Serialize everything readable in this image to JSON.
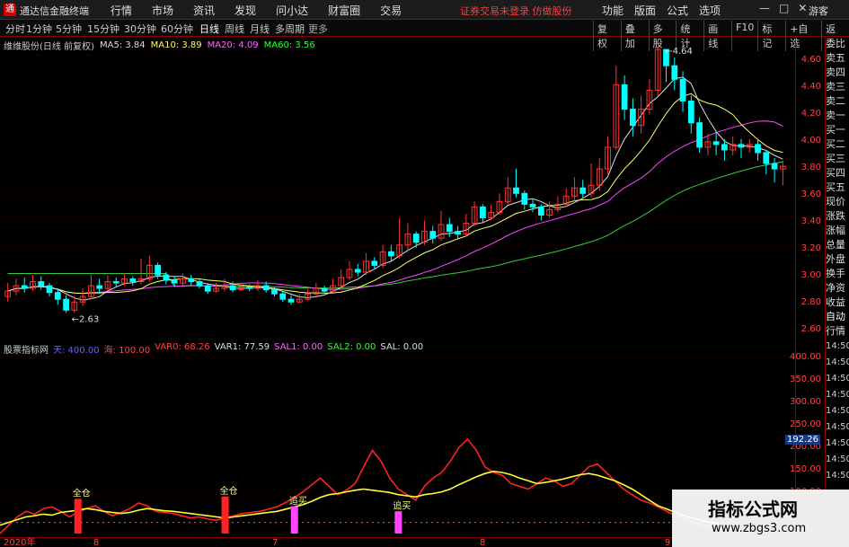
{
  "app": {
    "title": "通达信金融终端",
    "logo_glyph": "通",
    "guest": "游客"
  },
  "menu": [
    "行情",
    "市场",
    "资讯",
    "发现",
    "问小达",
    "财富圈",
    "交易"
  ],
  "warning": "证券交易未登录  仿做股份",
  "right_menu": [
    "功能",
    "版面",
    "公式",
    "选项"
  ],
  "window_controls": [
    "—",
    "□",
    "✕"
  ],
  "periods": [
    "分时",
    "1分钟",
    "5分钟",
    "15分钟",
    "30分钟",
    "60分钟",
    "日线",
    "周线",
    "月线",
    "多周期",
    "更多"
  ],
  "period_active": "日线",
  "toolbar": [
    "复权",
    "叠加",
    "多股",
    "统计",
    "画线",
    "F10",
    "标记",
    "+自选",
    "返回"
  ],
  "legend": {
    "stock": "维维股份(日线 前复权)",
    "ma5": "MA5: 3.84",
    "ma10": "MA10: 3.89",
    "ma20": "MA20: 4.09",
    "ma60": "MA60: 3.56"
  },
  "sub_legend": {
    "name": "股票指标网",
    "t1": "天: 400.00",
    "t2": "海: 100.00",
    "t3": "VAR0: 68.26",
    "t4": "VAR1: 77.59",
    "t5": "SAL1: 0.00",
    "t6": "SAL2: 0.00",
    "t7": "SAL: 0.00"
  },
  "price_axis": [
    "4.60",
    "4.40",
    "4.20",
    "4.00",
    "3.80",
    "3.60",
    "3.40",
    "3.20",
    "3.00",
    "2.80",
    "2.60"
  ],
  "sub_axis": [
    "400.00",
    "350.00",
    "300.00",
    "250.00",
    "200.00",
    "150.00",
    "100.00"
  ],
  "current_sub_value": "192.26",
  "annotations": {
    "high": "4.64",
    "low": "2.63"
  },
  "signals": {
    "full": "全仓",
    "chase": "追买"
  },
  "side_panel": [
    "委比",
    "卖五",
    "卖四",
    "卖三",
    "卖二",
    "卖一",
    "买一",
    "买二",
    "买三",
    "买四",
    "买五",
    "现价",
    "涨跌",
    "涨幅",
    "总量",
    "外盘",
    "换手",
    "净资",
    "收益"
  ],
  "side_panel_lower": [
    "自动",
    "行情"
  ],
  "side_times": [
    "14:50",
    "14:50",
    "14:50",
    "14:50",
    "14:50",
    "14:50",
    "14:50",
    "14:50",
    "14:50"
  ],
  "x_labels": [
    "2020年",
    "8",
    "7",
    "8",
    "9"
  ],
  "watermark": {
    "line1": "指标公式网",
    "line2": "www.zbgs3.com"
  },
  "colors": {
    "up": "#ff3333",
    "down": "#00ffff",
    "ma5": "#dddddd",
    "ma10": "#ffff66",
    "ma20": "#ff44ff",
    "ma60": "#33cc33",
    "axis": "#880000"
  },
  "chart_data": {
    "type": "candlestick",
    "y_range": [
      2.55,
      4.68
    ],
    "candles": [
      [
        2.82,
        2.86,
        2.92,
        2.78
      ],
      [
        2.86,
        2.9,
        2.95,
        2.83
      ],
      [
        2.9,
        2.88,
        2.96,
        2.85
      ],
      [
        2.88,
        2.93,
        2.98,
        2.86
      ],
      [
        2.93,
        2.9,
        2.97,
        2.87
      ],
      [
        2.9,
        2.85,
        2.92,
        2.82
      ],
      [
        2.85,
        2.8,
        2.88,
        2.76
      ],
      [
        2.8,
        2.72,
        2.83,
        2.7
      ],
      [
        2.72,
        2.78,
        2.82,
        2.7
      ],
      [
        2.78,
        2.82,
        2.88,
        2.75
      ],
      [
        2.82,
        2.9,
        2.98,
        2.8
      ],
      [
        2.9,
        2.88,
        2.95,
        2.84
      ],
      [
        2.88,
        2.93,
        2.98,
        2.86
      ],
      [
        2.93,
        2.92,
        2.96,
        2.89
      ],
      [
        2.92,
        2.95,
        2.99,
        2.9
      ],
      [
        2.95,
        2.93,
        2.97,
        2.9
      ],
      [
        2.93,
        2.95,
        3.1,
        2.91
      ],
      [
        2.95,
        3.05,
        3.12,
        2.93
      ],
      [
        3.05,
        2.98,
        3.07,
        2.95
      ],
      [
        2.98,
        2.94,
        3.0,
        2.91
      ],
      [
        2.94,
        2.92,
        2.97,
        2.89
      ],
      [
        2.92,
        2.95,
        2.99,
        2.9
      ],
      [
        2.95,
        2.93,
        2.98,
        2.9
      ],
      [
        2.93,
        2.9,
        2.95,
        2.88
      ],
      [
        2.9,
        2.86,
        2.92,
        2.84
      ],
      [
        2.86,
        2.88,
        2.92,
        2.85
      ],
      [
        2.88,
        2.9,
        2.95,
        2.86
      ],
      [
        2.9,
        2.87,
        2.93,
        2.85
      ],
      [
        2.87,
        2.89,
        2.92,
        2.86
      ],
      [
        2.89,
        2.88,
        2.91,
        2.86
      ],
      [
        2.88,
        2.9,
        2.94,
        2.86
      ],
      [
        2.9,
        2.87,
        2.93,
        2.85
      ],
      [
        2.87,
        2.84,
        2.89,
        2.82
      ],
      [
        2.84,
        2.8,
        2.86,
        2.78
      ],
      [
        2.8,
        2.78,
        2.83,
        2.76
      ],
      [
        2.78,
        2.8,
        2.84,
        2.77
      ],
      [
        2.8,
        2.84,
        2.88,
        2.79
      ],
      [
        2.84,
        2.88,
        2.92,
        2.82
      ],
      [
        2.88,
        2.86,
        2.9,
        2.84
      ],
      [
        2.86,
        2.9,
        2.95,
        2.85
      ],
      [
        2.9,
        2.96,
        3.02,
        2.88
      ],
      [
        2.96,
        3.02,
        3.08,
        2.94
      ],
      [
        3.02,
        3.0,
        3.06,
        2.97
      ],
      [
        3.0,
        3.08,
        3.14,
        2.98
      ],
      [
        3.08,
        3.05,
        3.11,
        3.02
      ],
      [
        3.05,
        3.15,
        3.2,
        3.03
      ],
      [
        3.15,
        3.12,
        3.2,
        3.08
      ],
      [
        3.12,
        3.2,
        3.4,
        3.1
      ],
      [
        3.2,
        3.28,
        3.36,
        3.16
      ],
      [
        3.28,
        3.22,
        3.3,
        3.18
      ],
      [
        3.22,
        3.3,
        3.38,
        3.2
      ],
      [
        3.3,
        3.25,
        3.34,
        3.21
      ],
      [
        3.25,
        3.35,
        3.45,
        3.23
      ],
      [
        3.35,
        3.3,
        3.4,
        3.26
      ],
      [
        3.3,
        3.28,
        3.34,
        3.24
      ],
      [
        3.28,
        3.36,
        3.43,
        3.26
      ],
      [
        3.36,
        3.48,
        3.52,
        3.34
      ],
      [
        3.48,
        3.4,
        3.5,
        3.36
      ],
      [
        3.4,
        3.44,
        3.5,
        3.38
      ],
      [
        3.44,
        3.52,
        3.58,
        3.42
      ],
      [
        3.52,
        3.62,
        3.7,
        3.5
      ],
      [
        3.62,
        3.58,
        3.76,
        3.55
      ],
      [
        3.58,
        3.5,
        3.6,
        3.46
      ],
      [
        3.5,
        3.48,
        3.54,
        3.44
      ],
      [
        3.48,
        3.42,
        3.5,
        3.38
      ],
      [
        3.42,
        3.46,
        3.52,
        3.4
      ],
      [
        3.46,
        3.5,
        3.56,
        3.44
      ],
      [
        3.5,
        3.56,
        3.62,
        3.48
      ],
      [
        3.56,
        3.62,
        3.7,
        3.52
      ],
      [
        3.62,
        3.58,
        3.68,
        3.55
      ],
      [
        3.58,
        3.64,
        3.8,
        3.55
      ],
      [
        3.64,
        3.76,
        3.84,
        3.6
      ],
      [
        3.76,
        3.92,
        4.0,
        3.72
      ],
      [
        3.92,
        4.38,
        4.52,
        3.9
      ],
      [
        4.38,
        4.2,
        4.45,
        4.12
      ],
      [
        4.2,
        4.08,
        4.28,
        4.0
      ],
      [
        4.08,
        4.2,
        4.3,
        4.02
      ],
      [
        4.2,
        4.34,
        4.42,
        4.16
      ],
      [
        4.34,
        4.64,
        4.66,
        4.3
      ],
      [
        4.64,
        4.52,
        4.62,
        4.4
      ],
      [
        4.52,
        4.42,
        4.58,
        4.34
      ],
      [
        4.42,
        4.26,
        4.48,
        4.18
      ],
      [
        4.26,
        4.1,
        4.3,
        4.02
      ],
      [
        4.1,
        3.92,
        4.14,
        3.88
      ],
      [
        3.92,
        3.96,
        4.02,
        3.86
      ],
      [
        3.96,
        3.94,
        4.04,
        3.86
      ],
      [
        3.94,
        3.9,
        3.98,
        3.82
      ],
      [
        3.9,
        3.94,
        4.0,
        3.86
      ],
      [
        3.94,
        3.92,
        3.98,
        3.84
      ],
      [
        3.92,
        3.94,
        3.98,
        3.88
      ],
      [
        3.94,
        3.88,
        3.98,
        3.82
      ],
      [
        3.88,
        3.8,
        3.9,
        3.72
      ],
      [
        3.8,
        3.76,
        3.84,
        3.66
      ],
      [
        3.76,
        3.78,
        3.82,
        3.64
      ]
    ],
    "sub_series": {
      "yellow": [
        95,
        100,
        105,
        110,
        112,
        115,
        113,
        118,
        120,
        122,
        125,
        123,
        120,
        118,
        116,
        118,
        122,
        125,
        123,
        121,
        120,
        118,
        116,
        114,
        112,
        110,
        108,
        110,
        112,
        114,
        116,
        118,
        120,
        124,
        128,
        132,
        138,
        145,
        150,
        152,
        155,
        158,
        160,
        158,
        156,
        154,
        150,
        148,
        146,
        150,
        152,
        155,
        160,
        168,
        175,
        182,
        188,
        192,
        190,
        186,
        180,
        175,
        170,
        172,
        175,
        178,
        182,
        186,
        188,
        185,
        180,
        175,
        168,
        160,
        150,
        140,
        130,
        124,
        118,
        112,
        108,
        104,
        100,
        98
      ],
      "red": [
        80,
        95,
        110,
        120,
        115,
        125,
        128,
        120,
        110,
        118,
        125,
        130,
        120,
        112,
        118,
        125,
        135,
        130,
        120,
        118,
        116,
        112,
        108,
        110,
        106,
        104,
        108,
        112,
        116,
        118,
        120,
        124,
        128,
        136,
        145,
        155,
        168,
        180,
        165,
        150,
        158,
        170,
        200,
        230,
        210,
        180,
        160,
        150,
        140,
        165,
        180,
        190,
        210,
        235,
        250,
        230,
        200,
        190,
        185,
        170,
        165,
        160,
        170,
        180,
        175,
        165,
        170,
        185,
        200,
        205,
        190,
        175,
        160,
        150,
        140,
        135,
        128,
        120,
        112,
        106,
        100,
        96,
        92,
        90
      ]
    },
    "signal_bars": [
      {
        "index": 9,
        "height": 70,
        "kind": "full"
      },
      {
        "index": 26,
        "height": 75,
        "kind": "full"
      },
      {
        "index": 34,
        "height": 55,
        "kind": "chase"
      },
      {
        "index": 46,
        "height": 45,
        "kind": "chase"
      }
    ],
    "sub_y_range": [
      80,
      410
    ]
  }
}
